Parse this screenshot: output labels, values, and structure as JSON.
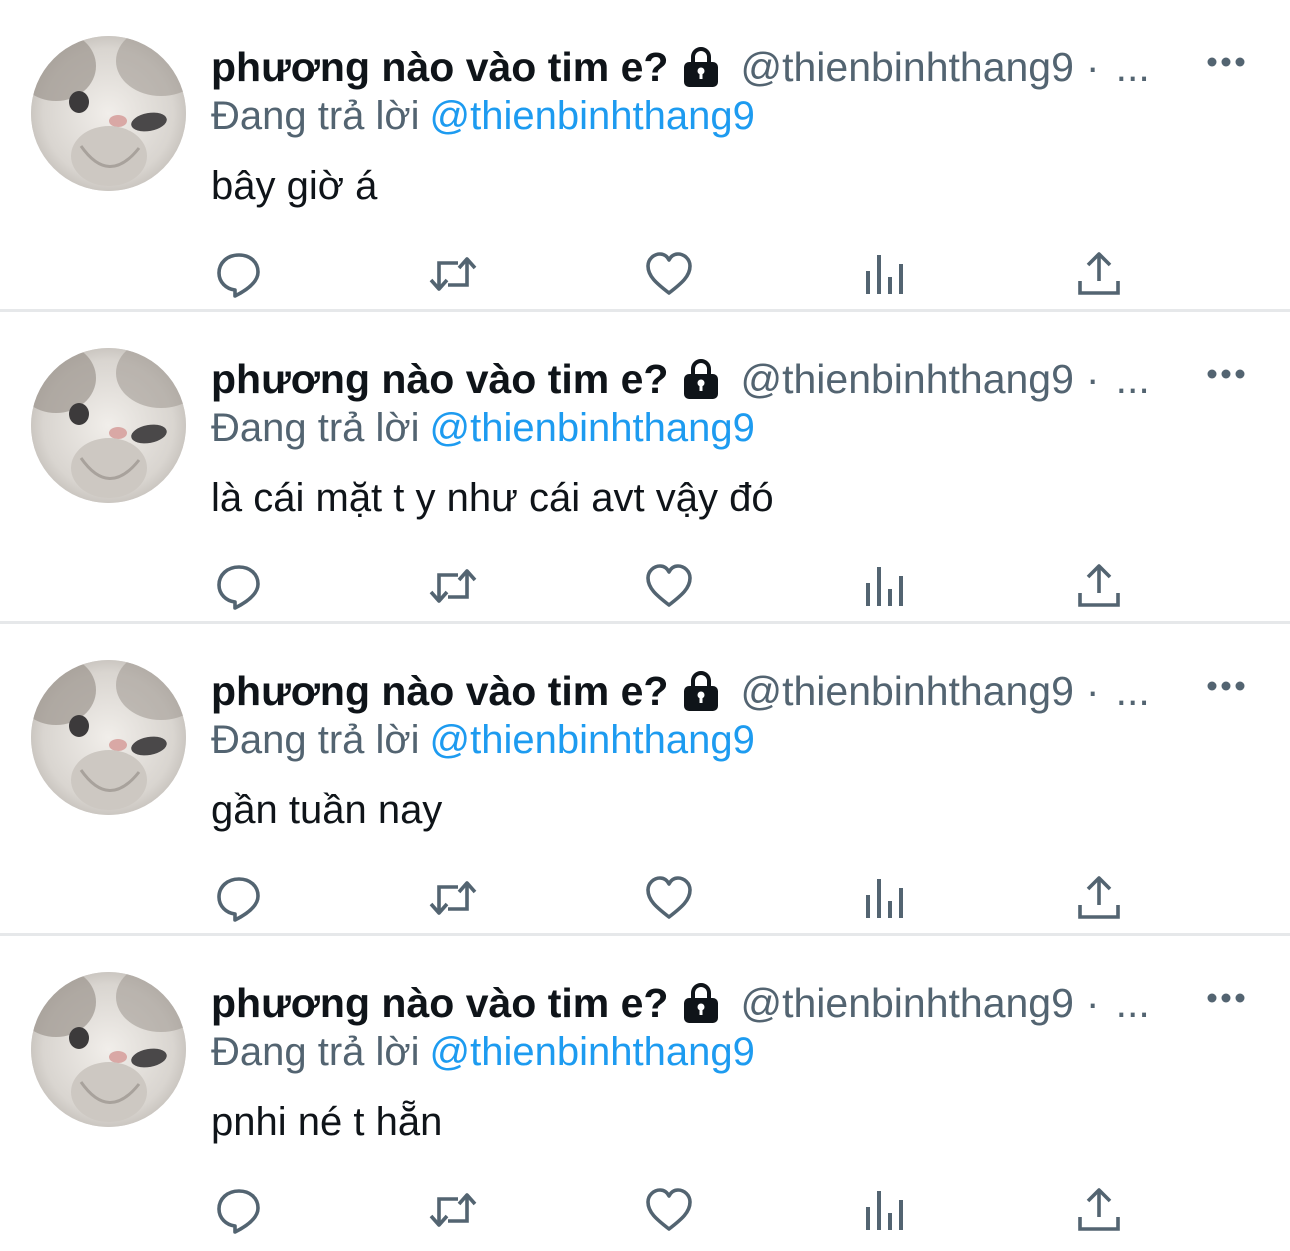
{
  "colors": {
    "name": "#0f1419",
    "secondary": "#536471",
    "mention": "#1d9bf0",
    "divider": "#e6e8ea"
  },
  "icons": {
    "lock": "lock-icon",
    "more": "more-horizontal-icon",
    "reply": "reply-icon",
    "retweet": "retweet-icon",
    "like": "heart-icon",
    "views": "analytics-icon",
    "share": "share-icon"
  },
  "tweets": [
    {
      "display_name": "phương nào vào tim e?",
      "handle": "@thienbinhthang9",
      "separator": "·",
      "time": "...",
      "reply_prefix": "Đang trả lời",
      "reply_mention": "@thienbinhthang9",
      "text": "bây giờ á"
    },
    {
      "display_name": "phương nào vào tim e?",
      "handle": "@thienbinhthang9",
      "separator": "·",
      "time": "...",
      "reply_prefix": "Đang trả lời",
      "reply_mention": "@thienbinhthang9",
      "text": "là cái mặt t y như cái avt vậy đó"
    },
    {
      "display_name": "phương nào vào tim e?",
      "handle": "@thienbinhthang9",
      "separator": "·",
      "time": "...",
      "reply_prefix": "Đang trả lời",
      "reply_mention": "@thienbinhthang9",
      "text": "gần tuần nay"
    },
    {
      "display_name": "phương nào vào tim e?",
      "handle": "@thienbinhthang9",
      "separator": "·",
      "time": "...",
      "reply_prefix": "Đang trả lời",
      "reply_mention": "@thienbinhthang9",
      "text": "pnhi né t hẵn"
    }
  ]
}
